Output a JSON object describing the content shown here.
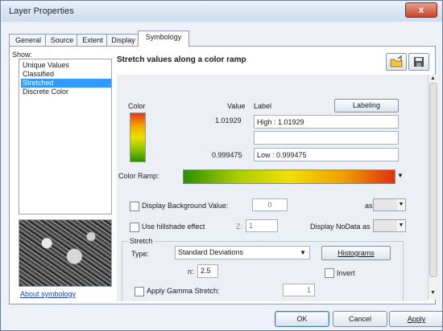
{
  "window": {
    "title": "Layer Properties",
    "close_glyph": "x"
  },
  "tabs": [
    "General",
    "Source",
    "Extent",
    "Display",
    "Symbology"
  ],
  "show": {
    "label": "Show:",
    "items": [
      "Unique Values",
      "Classified",
      "Stretched",
      "Discrete Color"
    ],
    "selected": "Stretched"
  },
  "about_link": "About symbology",
  "heading": "Stretch values along a color ramp",
  "table": {
    "color_header": "Color",
    "value_header": "Value",
    "label_header": "Label",
    "labeling_button": "Labeling",
    "high_value": "1.01929",
    "high_label": "High : 1.01929",
    "mid_label": "",
    "low_value": "0.999475",
    "low_label": "Low : 0.999475",
    "ramp_colors": [
      "#e8321a",
      "#f2a300",
      "#e8e300",
      "#8cc400",
      "#2b8f00"
    ]
  },
  "color_ramp": {
    "label": "Color Ramp:",
    "colors": [
      "#2b8f00",
      "#a8cc00",
      "#f0e000",
      "#f0a000",
      "#e03010"
    ]
  },
  "display_background": {
    "label": "Display Background Value:",
    "value": "0",
    "as_label": "as"
  },
  "hillshade": {
    "label": "Use hillshade effect",
    "z_label": "Z:",
    "z_value": "1",
    "nodata_label": "Display NoData as"
  },
  "stretch": {
    "group_label": "Stretch",
    "type_label": "Type:",
    "type_value": "Standard Deviations",
    "histograms_button": "Histograms",
    "n_label": "n:",
    "n_value": "2.5",
    "invert_label": "Invert",
    "gamma_label": "Apply Gamma Stretch:",
    "gamma_value": "1"
  },
  "footer": {
    "ok": "OK",
    "cancel": "Cancel",
    "apply": "Apply"
  },
  "icons": {
    "open": "folder-icon",
    "save": "save-icon"
  }
}
